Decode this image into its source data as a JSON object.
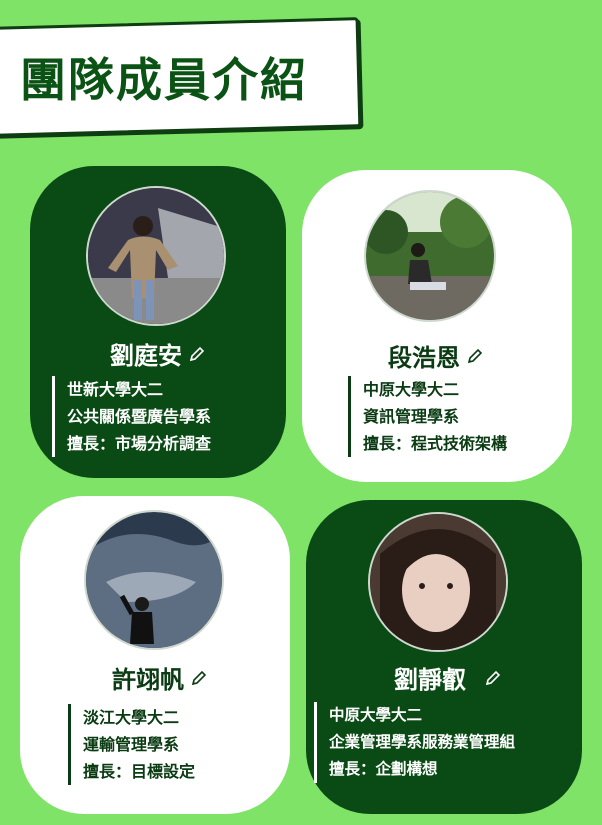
{
  "header": {
    "title": "團隊成員介紹"
  },
  "members": [
    {
      "name": "劉庭安",
      "school": "世新大學大二",
      "department": "公共關係暨廣告學系",
      "specialty": "擅長：市場分析調查",
      "pencil_icon": "pencil-icon"
    },
    {
      "name": "段浩恩",
      "school": "中原大學大二",
      "department": "資訊管理學系",
      "specialty": "擅長：程式技術架構",
      "pencil_icon": "pencil-icon"
    },
    {
      "name": "許翊帆",
      "school": "淡江大學大二",
      "department": "運輸管理學系",
      "specialty": "擅長：目標設定",
      "pencil_icon": "pencil-icon"
    },
    {
      "name": "劉靜叡",
      "school": "中原大學大二",
      "department": "企業管理學系服務業管理組",
      "specialty": "擅長：企劃構想",
      "pencil_icon": "pencil-icon"
    }
  ],
  "colors": {
    "background": "#7ee366",
    "dark_card": "#0a4a15",
    "light_card": "#ffffff",
    "title_text": "#0b5215"
  }
}
